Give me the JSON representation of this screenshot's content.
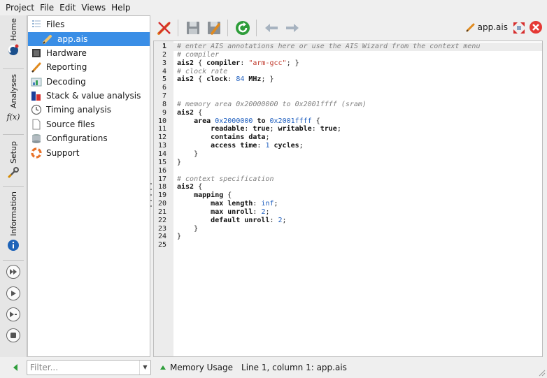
{
  "menubar": {
    "items": [
      "Project",
      "File",
      "Edit",
      "Views",
      "Help"
    ]
  },
  "sidetabs": {
    "home": "Home",
    "analyses": "Analyses",
    "fx": "f(x)",
    "setup": "Setup",
    "information": "Information"
  },
  "tree": {
    "items": [
      {
        "label": "Files",
        "icon": "files-icon"
      },
      {
        "label": "app.ais",
        "icon": "pencil-icon",
        "selected": true
      },
      {
        "label": "Hardware",
        "icon": "chip-icon"
      },
      {
        "label": "Reporting",
        "icon": "report-icon"
      },
      {
        "label": "Decoding",
        "icon": "decoding-icon"
      },
      {
        "label": "Stack & value analysis",
        "icon": "bar-chart-icon"
      },
      {
        "label": "Timing analysis",
        "icon": "clock-icon"
      },
      {
        "label": "Source files",
        "icon": "source-file-icon"
      },
      {
        "label": "Configurations",
        "icon": "database-icon"
      },
      {
        "label": "Support",
        "icon": "lifebuoy-icon"
      }
    ]
  },
  "toolbar": {
    "file_title": "app.ais"
  },
  "editor": {
    "lines": [
      {
        "n": "1",
        "html": "<span class=\"cm\"># enter AIS annotations here or use the AIS Wizard from the context menu</span>"
      },
      {
        "n": "2",
        "html": "<span class=\"cm\"># compiler</span>"
      },
      {
        "n": "3",
        "html": "<span class=\"kw\">ais2</span> { <span class=\"kw\">compiler</span>: <span class=\"st\">\"arm-gcc\"</span>; }"
      },
      {
        "n": "4",
        "html": "<span class=\"cm\"># clock rate</span>"
      },
      {
        "n": "5",
        "html": "<span class=\"kw\">ais2</span> { <span class=\"kw\">clock</span>: <span class=\"nm\">84</span> <span class=\"kw\">MHz</span>; }"
      },
      {
        "n": "6",
        "html": ""
      },
      {
        "n": "7",
        "html": ""
      },
      {
        "n": "8",
        "html": "<span class=\"cm\"># memory area 0x20000000 to 0x2001ffff (sram)</span>"
      },
      {
        "n": "9",
        "html": "<span class=\"kw\">ais2</span> {"
      },
      {
        "n": "10",
        "html": "    <span class=\"kw\">area</span> <span class=\"nm\">0x2000000</span> <span class=\"kw\">to</span> <span class=\"nm\">0x2001ffff</span> {"
      },
      {
        "n": "11",
        "html": "        <span class=\"kw\">readable</span>: <span class=\"kw\">true</span>; <span class=\"kw\">writable</span>: <span class=\"kw\">true</span>;"
      },
      {
        "n": "12",
        "html": "        <span class=\"kw\">contains data</span>;"
      },
      {
        "n": "13",
        "html": "        <span class=\"kw\">access time</span>: <span class=\"nm\">1</span> <span class=\"kw\">cycles</span>;"
      },
      {
        "n": "14",
        "html": "    }"
      },
      {
        "n": "15",
        "html": "}"
      },
      {
        "n": "16",
        "html": ""
      },
      {
        "n": "17",
        "html": "<span class=\"cm\"># context specification</span>"
      },
      {
        "n": "18",
        "html": "<span class=\"kw\">ais2</span> {"
      },
      {
        "n": "19",
        "html": "    <span class=\"kw\">mapping</span> {"
      },
      {
        "n": "20",
        "html": "        <span class=\"kw\">max length</span>: <span class=\"nm\">inf</span>;"
      },
      {
        "n": "21",
        "html": "        <span class=\"kw\">max unroll</span>: <span class=\"nm\">2</span>;"
      },
      {
        "n": "22",
        "html": "        <span class=\"kw\">default unroll</span>: <span class=\"nm\">2</span>;"
      },
      {
        "n": "23",
        "html": "    }"
      },
      {
        "n": "24",
        "html": "}"
      },
      {
        "n": "25",
        "html": ""
      }
    ]
  },
  "bottombar": {
    "filter_placeholder": "Filter...",
    "memory_usage": "Memory Usage",
    "status_text": "Line 1, column 1: app.ais"
  },
  "colors": {
    "selection": "#3a8ee6",
    "close_red": "#e53935",
    "reload_green": "#2e9d3a"
  }
}
